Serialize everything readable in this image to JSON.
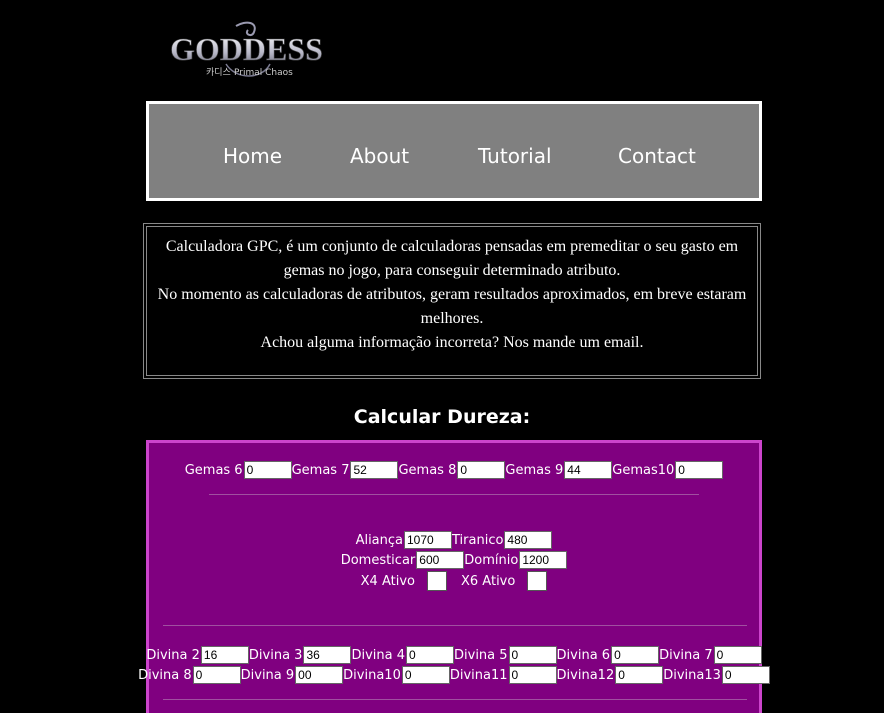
{
  "logo": {
    "title": "GODDESS",
    "subtitle": "Primal Chaos",
    "prefix": "카디스"
  },
  "nav": [
    {
      "label": "Home"
    },
    {
      "label": "About"
    },
    {
      "label": "Tutorial"
    },
    {
      "label": "Contact"
    }
  ],
  "intro": {
    "line1": "Calculadora GPC, é um conjunto de calculadoras pensadas em premeditar o seu gasto em gemas no jogo, para conseguir determinado atributo.",
    "line2": "No momento as calculadoras de atributos, geram resultados aproximados, em breve estaram melhores.",
    "line3": "Achou alguma informação incorreta? Nos mande um email."
  },
  "calc": {
    "heading": "Calcular Dureza:",
    "gemas": [
      {
        "label": "Gemas 6",
        "value": "0"
      },
      {
        "label": "Gemas 7",
        "value": "52"
      },
      {
        "label": "Gemas 8",
        "value": "0"
      },
      {
        "label": "Gemas 9",
        "value": "44"
      },
      {
        "label": "Gemas10",
        "value": "0"
      }
    ],
    "alianca": {
      "label": "Aliança",
      "value": "1070"
    },
    "tiranico": {
      "label": "Tiranico",
      "value": "480"
    },
    "domesticar": {
      "label": "Domesticar",
      "value": "600"
    },
    "dominio": {
      "label": "Domínio",
      "value": "1200"
    },
    "x4": {
      "label": "X4 Ativo"
    },
    "x6": {
      "label": "X6 Ativo"
    },
    "divinas_row1": [
      {
        "label": "Divina 2",
        "value": "16"
      },
      {
        "label": "Divina 3",
        "value": "36"
      },
      {
        "label": "Divina 4",
        "value": "0"
      },
      {
        "label": "Divina 5",
        "value": "0"
      },
      {
        "label": "Divina 6",
        "value": "0"
      },
      {
        "label": "Divina 7",
        "value": "0"
      }
    ],
    "divinas_row2": [
      {
        "label": "Divina 8",
        "value": "0"
      },
      {
        "label": "Divina 9",
        "value": "00"
      },
      {
        "label": "Divina10",
        "value": "0"
      },
      {
        "label": "Divina11",
        "value": "0"
      },
      {
        "label": "Divina12",
        "value": "0"
      },
      {
        "label": "Divina13",
        "value": "0"
      }
    ]
  }
}
